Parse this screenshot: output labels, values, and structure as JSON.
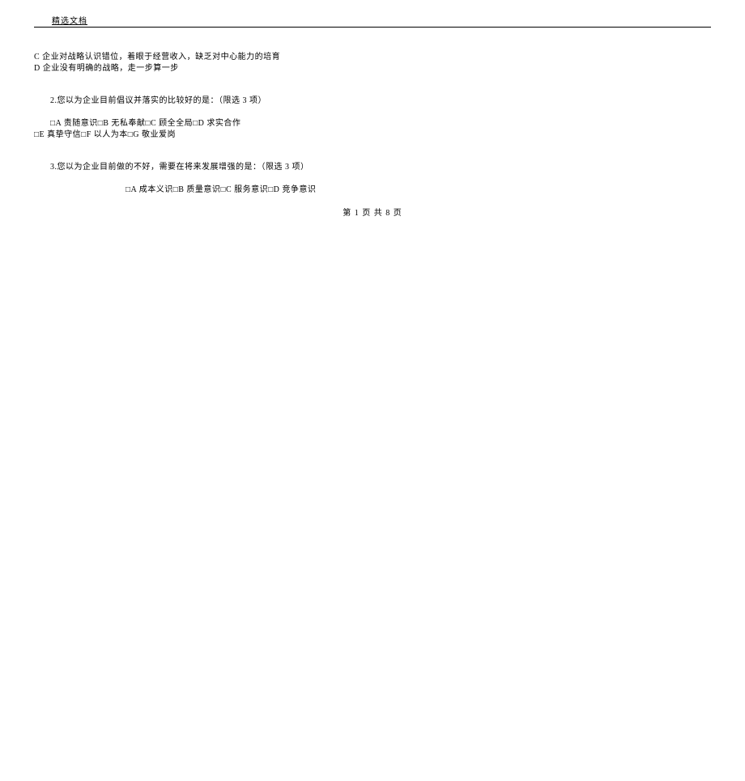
{
  "header": {
    "title": "精选文档"
  },
  "content": {
    "optionC": "C 企业对战略认识错位，着眼于经营收入，缺乏对中心能力的培育",
    "optionD": "D 企业没有明确的战略，走一步算一步",
    "question2": {
      "text": "2.您以为企业目前倡议并落实的比较好的是：（限选 3 项）",
      "optionsLine1": "□A 责随意识□B 无私奉献□C 顾全全局□D 求实合作",
      "optionsLine2": "□E 真挚守信□F 以人为本□G 敬业爱岗"
    },
    "question3": {
      "text": "3.您以为企业目前做的不好，需要在将来发展增强的是：（限选 3 项）",
      "optionsLine1": "□A 成本义识□B 质量意识□C 服务意识□D 竞争意识"
    }
  },
  "footer": {
    "pageInfo": "第 1 页 共 8 页"
  }
}
